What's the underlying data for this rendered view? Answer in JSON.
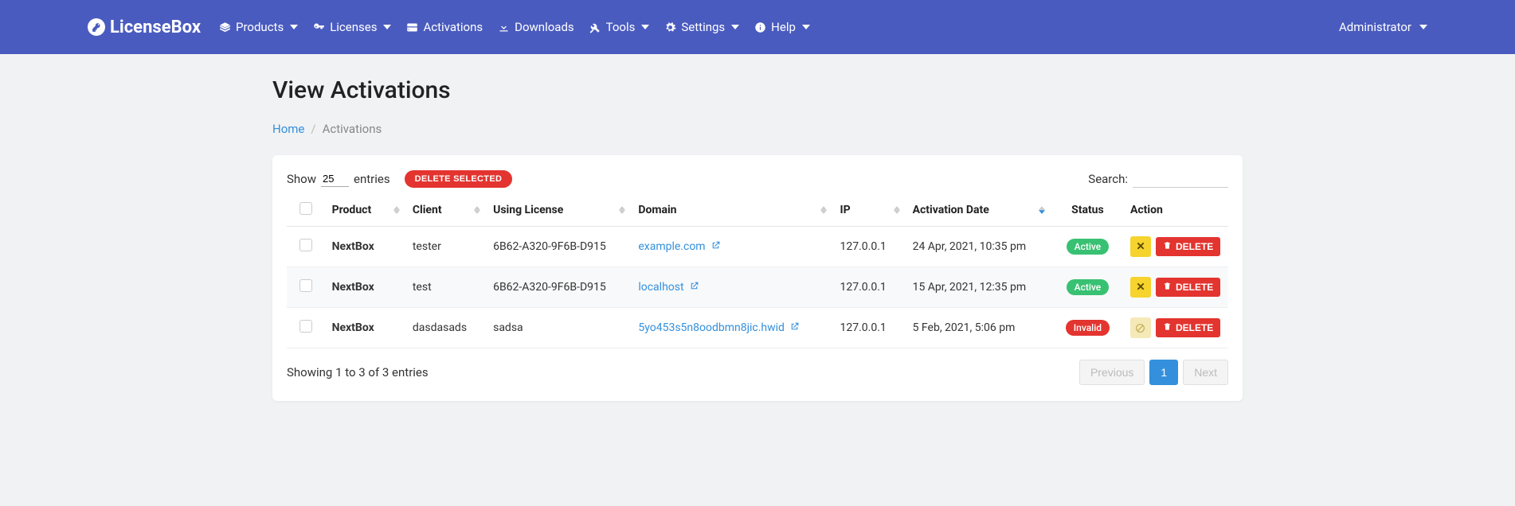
{
  "brand": "LicenseBox",
  "nav": [
    {
      "label": "Products",
      "icon": "layers",
      "dropdown": true
    },
    {
      "label": "Licenses",
      "icon": "key",
      "dropdown": true
    },
    {
      "label": "Activations",
      "icon": "hdd",
      "dropdown": false
    },
    {
      "label": "Downloads",
      "icon": "download",
      "dropdown": false
    },
    {
      "label": "Tools",
      "icon": "tools",
      "dropdown": true
    },
    {
      "label": "Settings",
      "icon": "cogs",
      "dropdown": true
    },
    {
      "label": "Help",
      "icon": "info",
      "dropdown": true
    }
  ],
  "user": "Administrator",
  "page": {
    "title": "View Activations",
    "breadcrumb_home": "Home",
    "breadcrumb_current": "Activations"
  },
  "controls": {
    "show_label_pre": "Show",
    "show_value": "25",
    "show_label_post": "entries",
    "delete_selected": "DELETE SELECTED",
    "search_label": "Search:"
  },
  "columns": [
    "",
    "Product",
    "Client",
    "Using License",
    "Domain",
    "IP",
    "Activation Date",
    "Status",
    "Action"
  ],
  "sorted_column_index": 6,
  "sorted_dir": "desc",
  "rows": [
    {
      "product": "NextBox",
      "client": "tester",
      "license": "6B62-A320-9F6B-D915",
      "domain": "example.com",
      "ip": "127.0.0.1",
      "date": "24 Apr, 2021, 10:35 pm",
      "status": "Active",
      "deact_disabled": false
    },
    {
      "product": "NextBox",
      "client": "test",
      "license": "6B62-A320-9F6B-D915",
      "domain": "localhost",
      "ip": "127.0.0.1",
      "date": "15 Apr, 2021, 12:35 pm",
      "status": "Active",
      "deact_disabled": false
    },
    {
      "product": "NextBox",
      "client": "dasdasads",
      "license": "sadsa",
      "domain": "5yo453s5n8oodbmn8jic.hwid",
      "ip": "127.0.0.1",
      "date": "5 Feb, 2021, 5:06 pm",
      "status": "Invalid",
      "deact_disabled": true
    }
  ],
  "delete_label": "DELETE",
  "footer": {
    "info": "Showing 1 to 3 of 3 entries",
    "prev": "Previous",
    "page": "1",
    "next": "Next"
  }
}
